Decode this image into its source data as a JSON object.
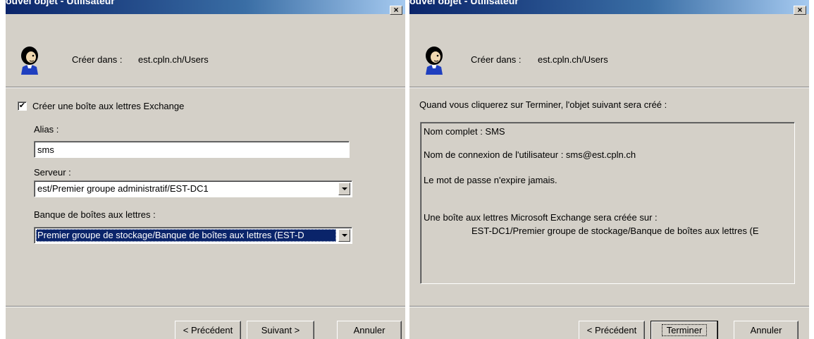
{
  "left": {
    "title": "ouvel objet - Utilisateur",
    "close_glyph": "×",
    "icon": "user-icon",
    "create_in_label": "Créer dans :",
    "create_in_value": "est.cpln.ch/Users",
    "exchange_checkbox": {
      "checked": true,
      "label": "Créer une boîte aux lettres Exchange"
    },
    "alias": {
      "label": "Alias :",
      "value": "sms"
    },
    "server": {
      "label": "Serveur :",
      "value": "est/Premier groupe administratif/EST-DC1"
    },
    "mailbox_store": {
      "label": "Banque de boîtes aux lettres :",
      "value": "Premier groupe de stockage/Banque de boîtes aux lettres (EST-D"
    },
    "buttons": {
      "back": "< Précédent",
      "next": "Suivant >",
      "cancel": "Annuler"
    }
  },
  "right": {
    "title": "ouvel objet - Utilisateur",
    "close_glyph": "×",
    "icon": "user-icon",
    "create_in_label": "Créer dans :",
    "create_in_value": "est.cpln.ch/Users",
    "intro": "Quand vous cliquerez sur Terminer, l'objet suivant sera créé :",
    "summary": {
      "full_name": "Nom complet : SMS",
      "logon_name": "Nom de connexion de l'utilisateur : sms@est.cpln.ch",
      "password": "Le mot de passe n'expire jamais.",
      "mailbox_line1": "Une boîte aux lettres Microsoft Exchange sera créée sur :",
      "mailbox_line2": "EST-DC1/Premier groupe de stockage/Banque de boîtes aux lettres (E"
    },
    "buttons": {
      "back": "< Précédent",
      "finish": "Terminer",
      "cancel": "Annuler"
    }
  },
  "colors": {
    "dialog_bg": "#d4d0c8",
    "title_bar": "#0a246a",
    "selection": "#0a246a"
  }
}
